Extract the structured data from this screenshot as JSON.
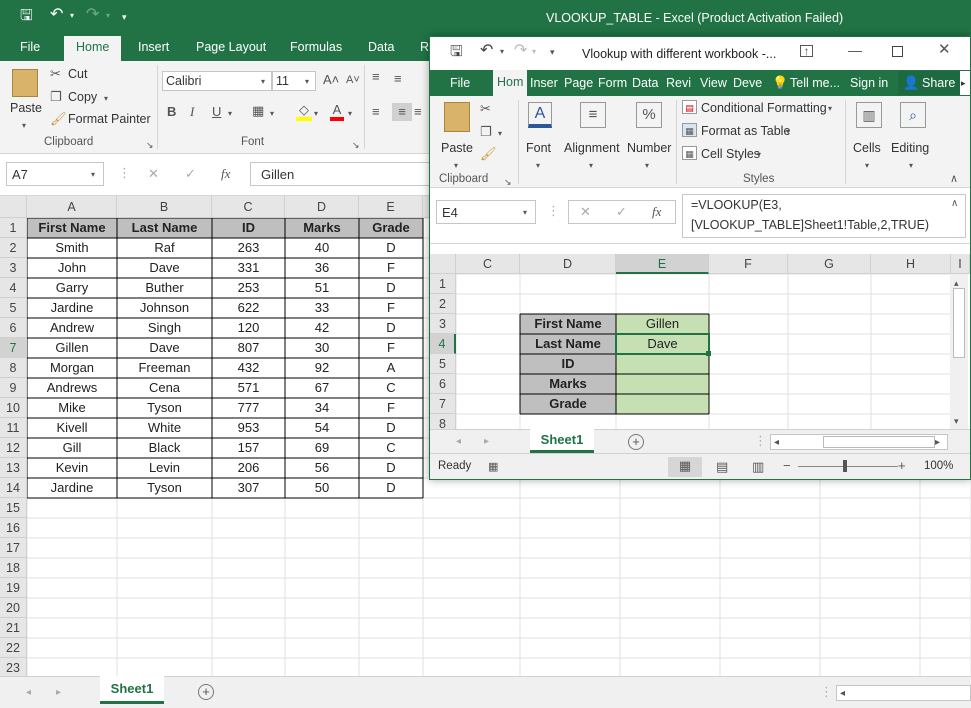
{
  "main": {
    "title": "VLOOKUP_TABLE - Excel (Product Activation Failed)",
    "tabs": [
      "File",
      "Home",
      "Insert",
      "Page Layout",
      "Formulas",
      "Data",
      "R"
    ],
    "clipboard": {
      "paste": "Paste",
      "cut": "Cut",
      "copy": "Copy",
      "format_painter": "Format Painter",
      "group": "Clipboard"
    },
    "font": {
      "name": "Calibri",
      "size": "11",
      "group": "Font"
    },
    "namebox": "A7",
    "fx": "fx",
    "formula": "Gillen",
    "columns": [
      "A",
      "B",
      "C",
      "D",
      "E"
    ],
    "headers": [
      "First Name",
      "Last Name",
      "ID",
      "Marks",
      "Grade"
    ],
    "rows": [
      [
        "Smith",
        "Raf",
        "263",
        "40",
        "D"
      ],
      [
        "John",
        "Dave",
        "331",
        "36",
        "F"
      ],
      [
        "Garry",
        "Buther",
        "253",
        "51",
        "D"
      ],
      [
        "Jardine",
        "Johnson",
        "622",
        "33",
        "F"
      ],
      [
        "Andrew",
        "Singh",
        "120",
        "42",
        "D"
      ],
      [
        "Gillen",
        "Dave",
        "807",
        "30",
        "F"
      ],
      [
        "Morgan",
        "Freeman",
        "432",
        "92",
        "A"
      ],
      [
        "Andrews",
        "Cena",
        "571",
        "67",
        "C"
      ],
      [
        "Mike",
        "Tyson",
        "777",
        "34",
        "F"
      ],
      [
        "Kivell",
        "White",
        "953",
        "54",
        "D"
      ],
      [
        "Gill",
        "Black",
        "157",
        "69",
        "C"
      ],
      [
        "Kevin",
        "Levin",
        "206",
        "56",
        "D"
      ],
      [
        "Jardine",
        "Tyson",
        "307",
        "50",
        "D"
      ]
    ],
    "row_numbers": [
      "1",
      "2",
      "3",
      "4",
      "5",
      "6",
      "7",
      "8",
      "9",
      "10",
      "11",
      "12",
      "13",
      "14",
      "15",
      "16",
      "17",
      "18",
      "19",
      "20",
      "21",
      "22",
      "23"
    ],
    "sheet_tab": "Sheet1"
  },
  "second": {
    "title": "Vlookup with different workbook -...",
    "tabs": [
      "File",
      "Hom",
      "Inser",
      "Page",
      "Form",
      "Data",
      "Revi",
      "View",
      "Deve",
      "Tell me...",
      "Sign in",
      "Share"
    ],
    "ribbon": {
      "paste": "Paste",
      "clipboard": "Clipboard",
      "font": "Font",
      "alignment": "Alignment",
      "number": "Number",
      "percent": "%",
      "cond_format": "Conditional Formatting",
      "format_table": "Format as Table",
      "cell_styles": "Cell Styles",
      "styles": "Styles",
      "cells": "Cells",
      "editing": "Editing"
    },
    "namebox": "E4",
    "fx": "fx",
    "formula_line1": "=VLOOKUP(E3,",
    "formula_line2": "[VLOOKUP_TABLE]Sheet1!Table,2,TRUE)",
    "columns": [
      "C",
      "D",
      "E",
      "F",
      "G",
      "H",
      "I"
    ],
    "row_numbers": [
      "1",
      "2",
      "3",
      "4",
      "5",
      "6",
      "7",
      "8"
    ],
    "labels": [
      "First Name",
      "Last Name",
      "ID",
      "Marks",
      "Grade"
    ],
    "values": [
      "Gillen",
      "Dave",
      "",
      "",
      ""
    ],
    "sheet_tab": "Sheet1",
    "status": "Ready",
    "zoom": "100%"
  },
  "colors": {
    "excel_green": "#217346",
    "header_gray": "#bfbfbf",
    "lookup_green": "#c6e0b4",
    "selected_col": "#d2d2d2"
  }
}
